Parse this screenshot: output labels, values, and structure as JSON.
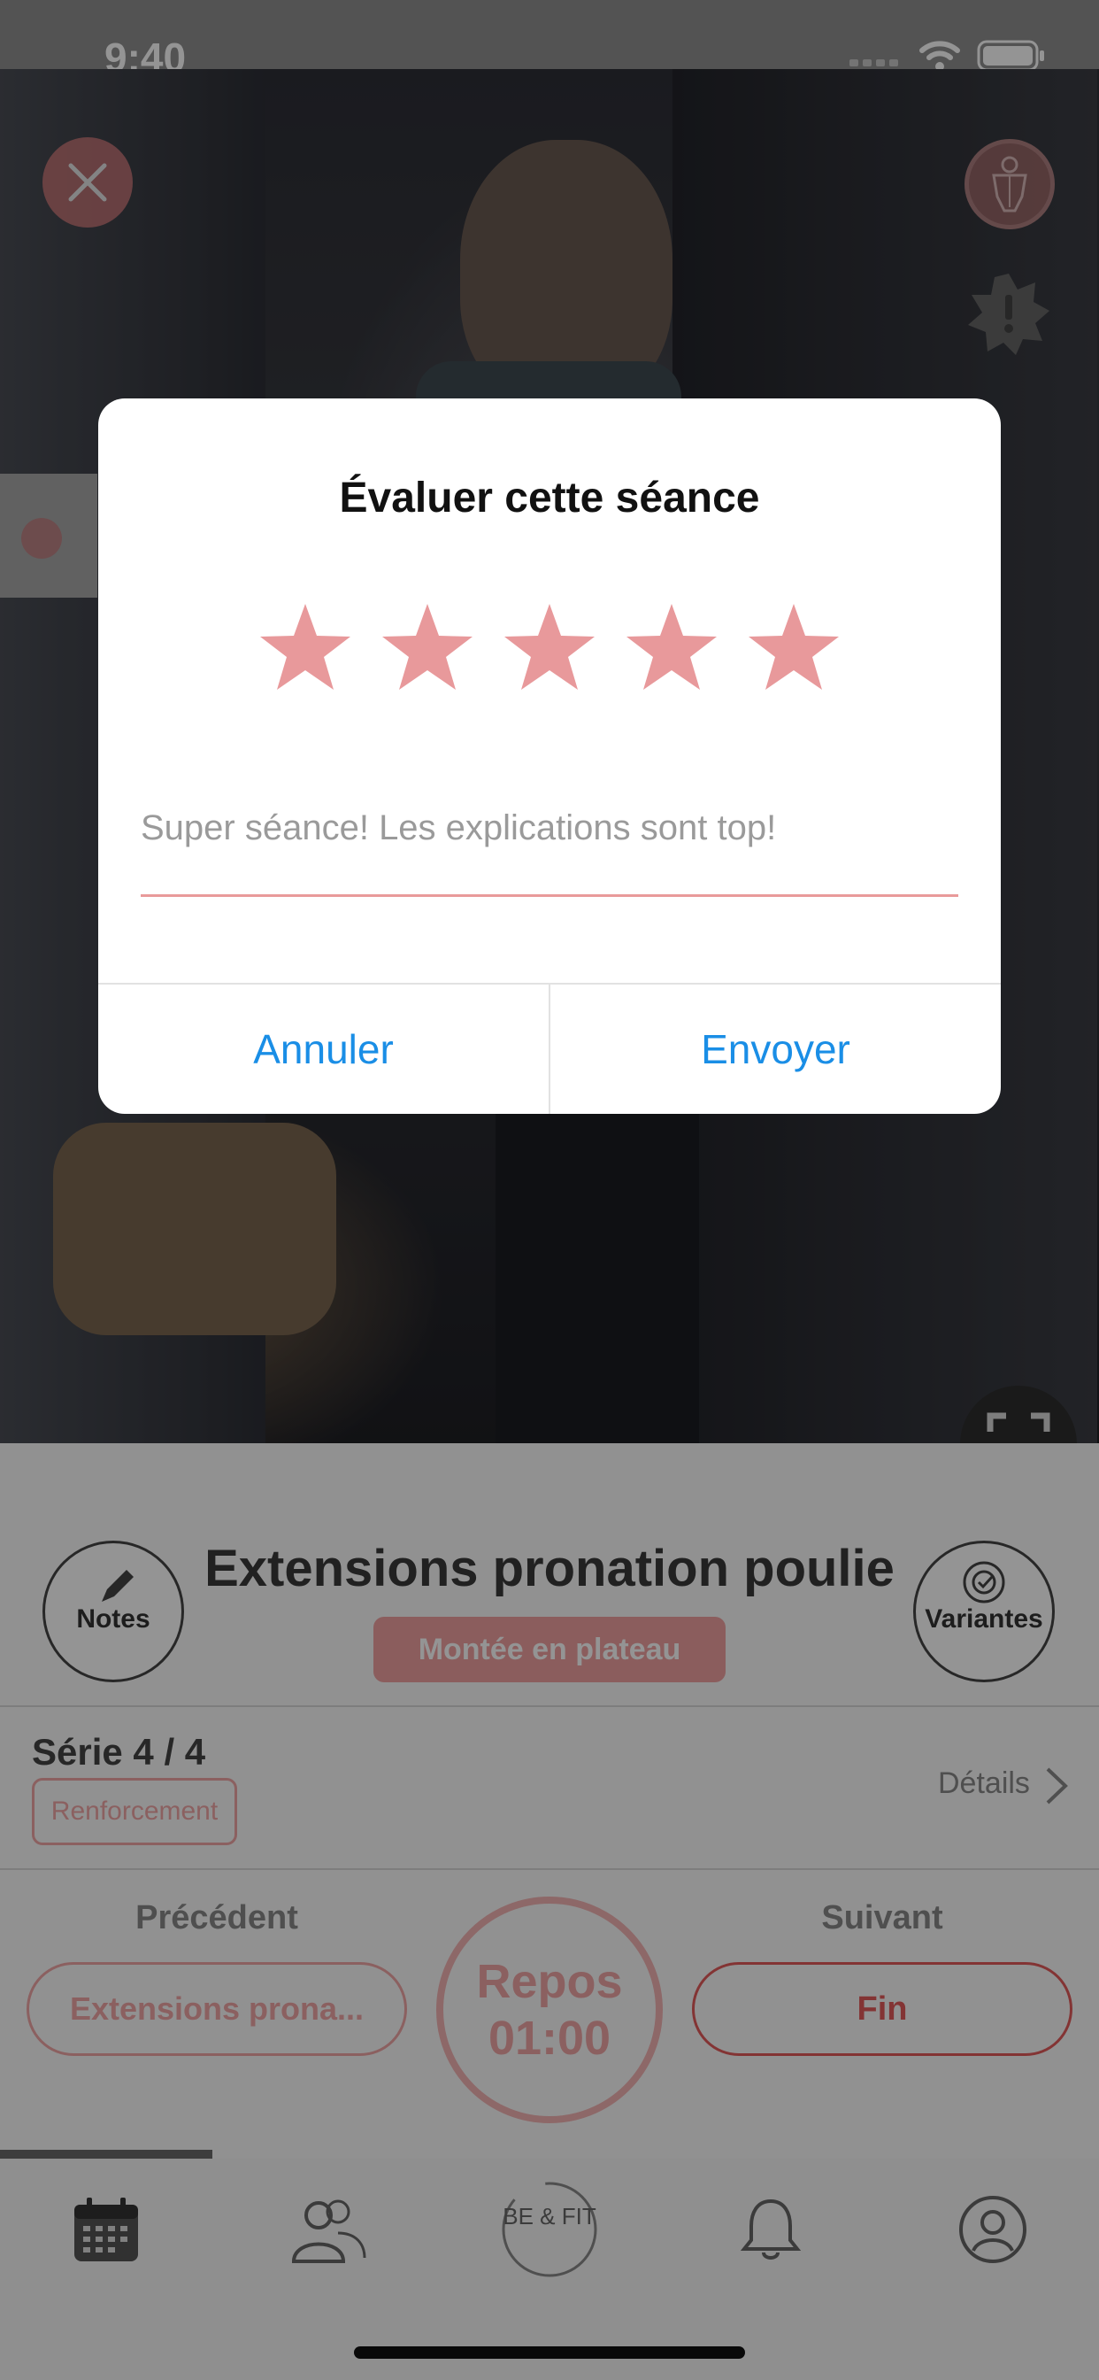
{
  "status_bar": {
    "time": "9:40"
  },
  "exercise": {
    "notes_label": "Notes",
    "variants_label": "Variantes",
    "title": "Extensions pronation poulie",
    "badge": "Montée en plateau",
    "series": "Série 4 / 4",
    "series_type": "Renforcement",
    "details_label": "Détails",
    "previous_label": "Précédent",
    "previous_exercise": "Extensions prona...",
    "next_label": "Suivant",
    "next_exercise": "Fin",
    "rest_label": "Repos",
    "rest_time": "01:00"
  },
  "tab_bar": {
    "items": [
      "calendar-icon",
      "community-icon",
      "befit-logo-icon",
      "bell-icon",
      "profile-icon"
    ],
    "logo_text": "BE & FIT"
  },
  "rating_dialog": {
    "title": "Évaluer cette séance",
    "rating": 5,
    "max_rating": 5,
    "star_color": "#e8999b",
    "comment_placeholder": "Super séance! Les explications sont top!",
    "cancel_label": "Annuler",
    "send_label": "Envoyer"
  },
  "colors": {
    "accent_blue": "#1a8ee6",
    "accent_pink": "#e25a5a"
  }
}
